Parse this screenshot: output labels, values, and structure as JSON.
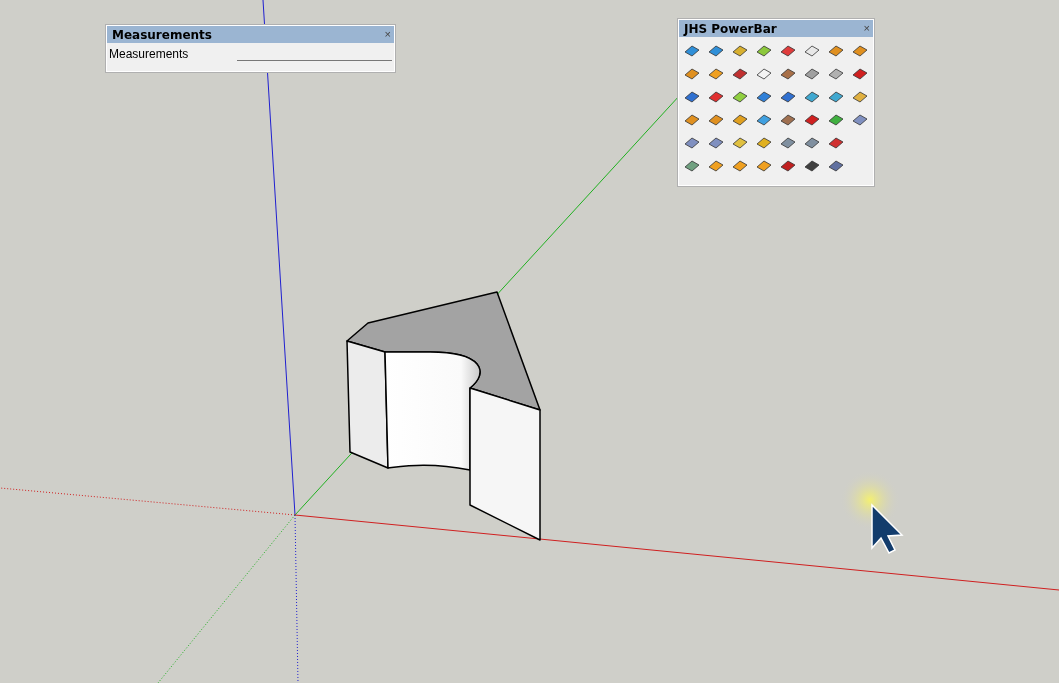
{
  "measurements_panel": {
    "title": "Measurements",
    "close": "×",
    "label": "Measurements"
  },
  "powerbar_panel": {
    "title": "JHS PowerBar",
    "close": "×"
  }
}
